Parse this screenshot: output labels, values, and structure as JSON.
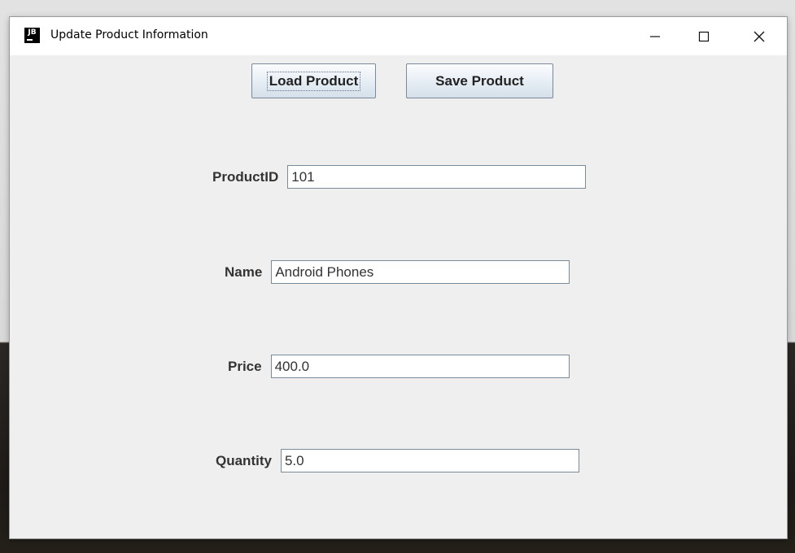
{
  "window": {
    "title": "Update Product Information",
    "icon_text": "JB",
    "controls": {
      "minimize_icon": "minimize-icon",
      "maximize_icon": "maximize-icon",
      "close_icon": "close-icon"
    }
  },
  "toolbar": {
    "load_label": "Load Product",
    "save_label": "Save Product"
  },
  "form": {
    "product_id": {
      "label": "ProductID",
      "value": "101"
    },
    "name": {
      "label": "Name",
      "value": "Android Phones"
    },
    "price": {
      "label": "Price",
      "value": "400.0"
    },
    "quantity": {
      "label": "Quantity",
      "value": "5.0"
    }
  },
  "colors": {
    "window_bg": "#efefef",
    "titlebar_bg": "#ffffff",
    "button_border": "#7a8a99"
  }
}
